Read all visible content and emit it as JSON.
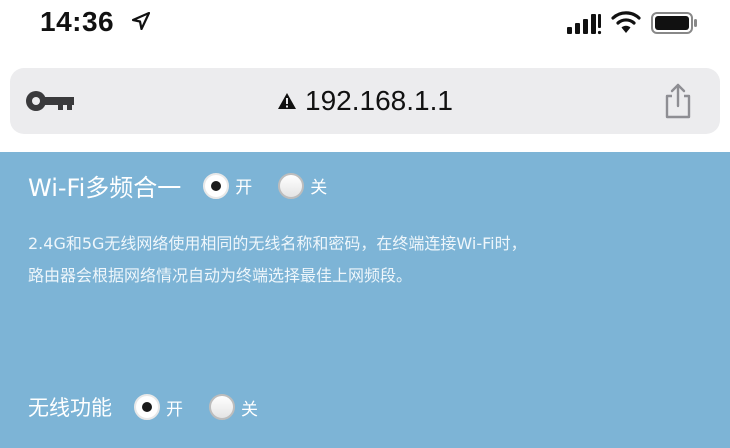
{
  "status_bar": {
    "time": "14:36",
    "icons": [
      "location-arrow-icon",
      "cellular-signal-icon",
      "wifi-icon",
      "battery-icon"
    ]
  },
  "address_bar": {
    "url": "192.168.1.1",
    "icons": [
      "key-icon",
      "warning-icon",
      "share-icon"
    ]
  },
  "wifi_merge": {
    "label": "Wi-Fi多频合一",
    "options": [
      "开",
      "关"
    ],
    "selected": "开",
    "description_line1": "2.4G和5G无线网络使用相同的无线名称和密码，在终端连接Wi-Fi时，",
    "description_line2": "路由器会根据网络情况自动为终端选择最佳上网频段。"
  },
  "wireless": {
    "label": "无线功能",
    "options": [
      "开",
      "关"
    ],
    "selected": "开"
  },
  "colors": {
    "panel_bg": "#7db4d6",
    "address_bar_bg": "#ececee",
    "text_white": "#ffffff"
  }
}
